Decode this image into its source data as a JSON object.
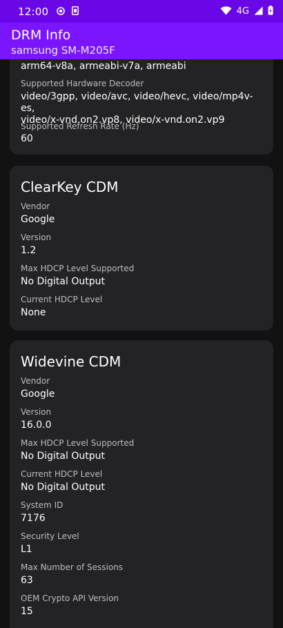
{
  "status_bar": {
    "time": "12:00",
    "network": "4G"
  },
  "app_bar": {
    "title": "DRM Info",
    "subtitle": "samsung SM-M205F"
  },
  "card_device": {
    "abis_value": "arm64-v8a, armeabi-v7a, armeabi",
    "hw_decoder_label": "Supported Hardware Decoder",
    "hw_decoder_value_line1": "video/3gpp, video/avc, video/hevc, video/mp4v-es,",
    "hw_decoder_value_line2": "video/x-vnd.on2.vp8, video/x-vnd.on2.vp9",
    "refresh_label": "Supported Refresh Rate (Hz)",
    "refresh_value": "60"
  },
  "card_clearkey": {
    "title": "ClearKey CDM",
    "vendor_label": "Vendor",
    "vendor_value": "Google",
    "version_label": "Version",
    "version_value": "1.2",
    "max_hdcp_label": "Max HDCP Level Supported",
    "max_hdcp_value": "No Digital Output",
    "cur_hdcp_label": "Current HDCP Level",
    "cur_hdcp_value": "None"
  },
  "card_widevine": {
    "title": "Widevine CDM",
    "vendor_label": "Vendor",
    "vendor_value": "Google",
    "version_label": "Version",
    "version_value": "16.0.0",
    "max_hdcp_label": "Max HDCP Level Supported",
    "max_hdcp_value": "No Digital Output",
    "cur_hdcp_label": "Current HDCP Level",
    "cur_hdcp_value": "No Digital Output",
    "system_id_label": "System ID",
    "system_id_value": "7176",
    "security_label": "Security Level",
    "security_value": "L1",
    "max_sessions_label": "Max Number of Sessions",
    "max_sessions_value": "63",
    "oem_crypto_label": "OEM Crypto API Version",
    "oem_crypto_value": "15"
  }
}
